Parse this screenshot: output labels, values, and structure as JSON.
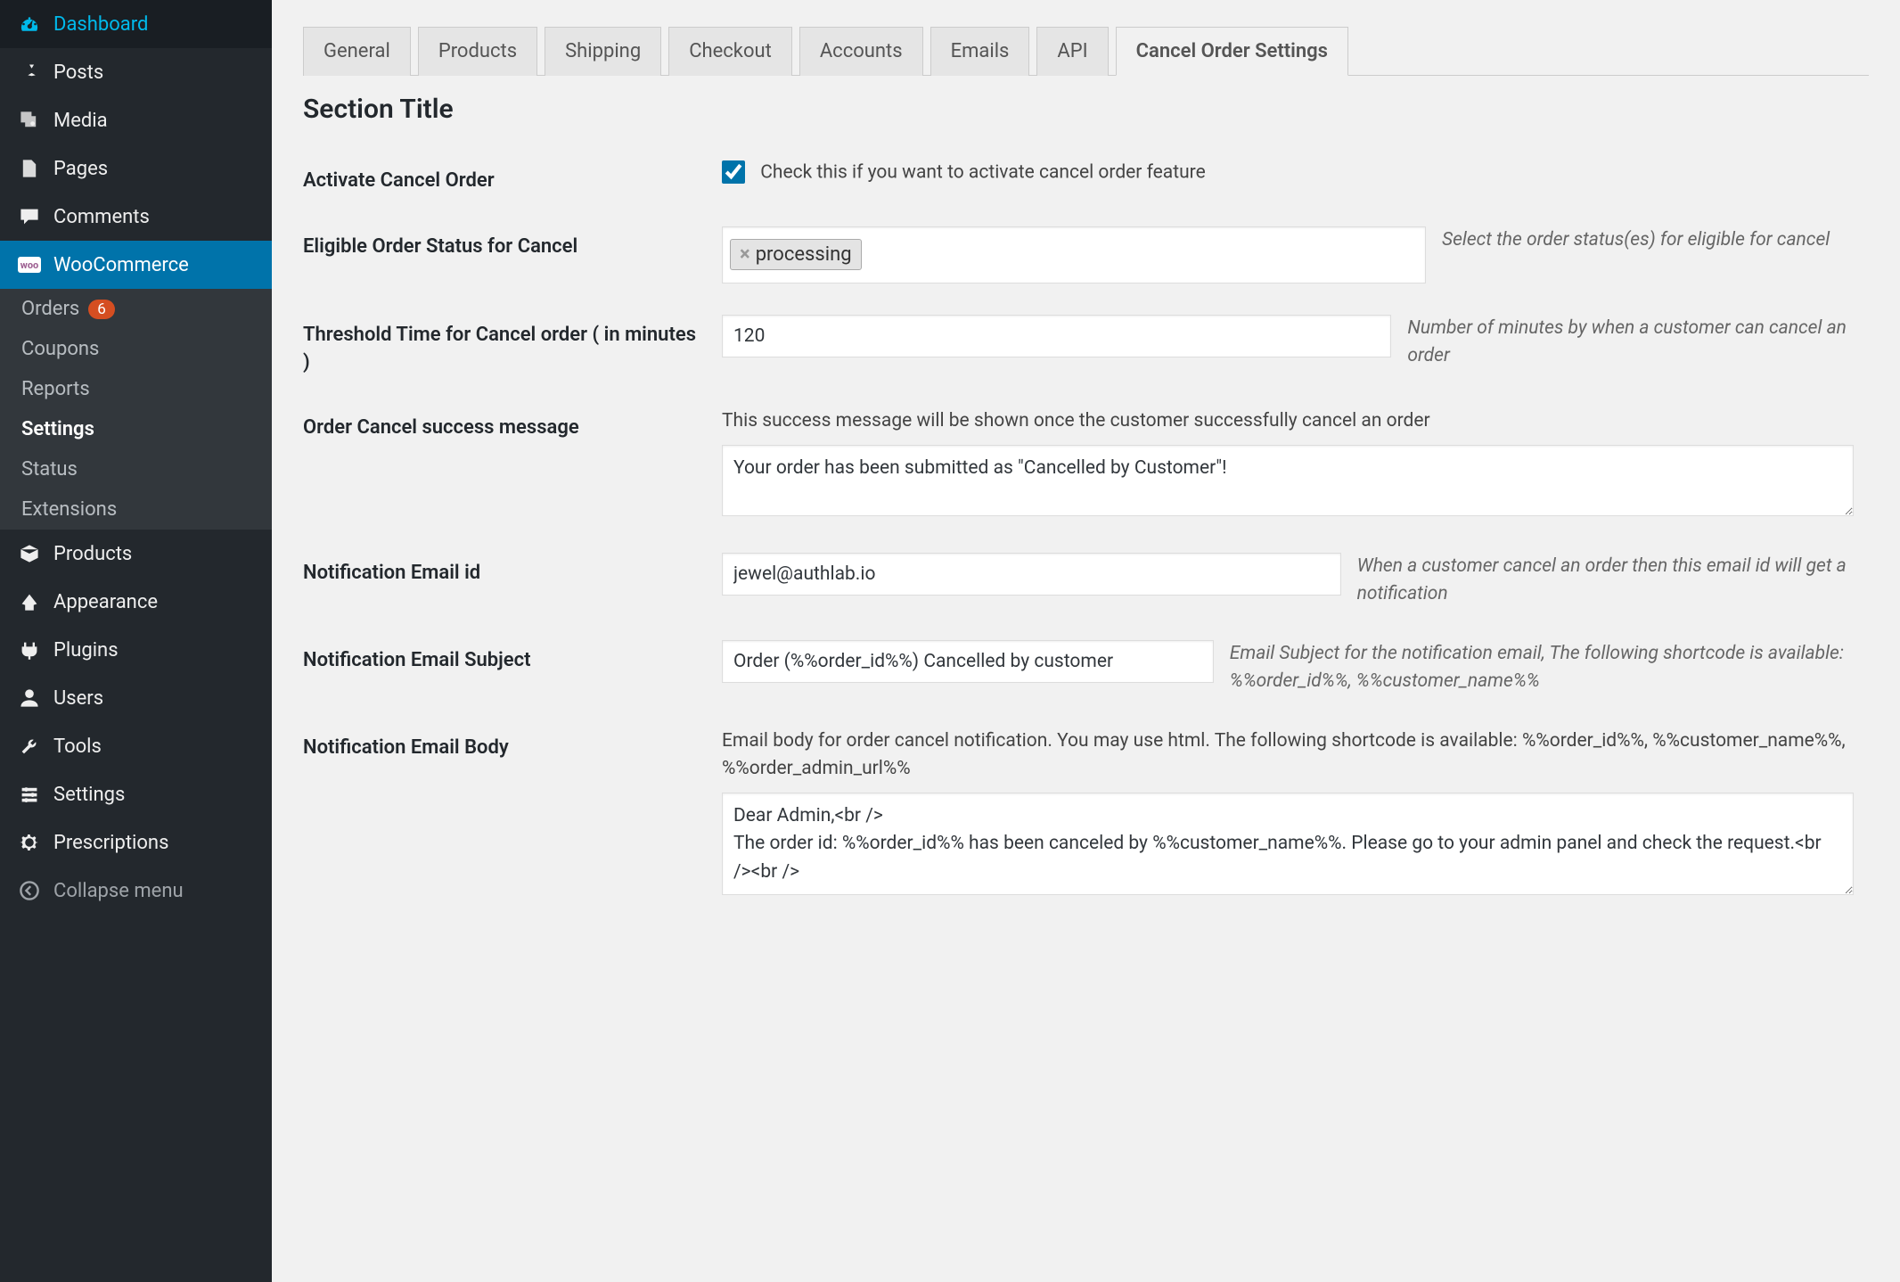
{
  "sidebar": {
    "items": [
      {
        "label": "Dashboard"
      },
      {
        "label": "Posts"
      },
      {
        "label": "Media"
      },
      {
        "label": "Pages"
      },
      {
        "label": "Comments"
      },
      {
        "label": "WooCommerce"
      },
      {
        "label": "Products"
      },
      {
        "label": "Appearance"
      },
      {
        "label": "Plugins"
      },
      {
        "label": "Users"
      },
      {
        "label": "Tools"
      },
      {
        "label": "Settings"
      },
      {
        "label": "Prescriptions"
      },
      {
        "label": "Collapse menu"
      }
    ],
    "woo_sub": [
      {
        "label": "Orders",
        "badge": "6"
      },
      {
        "label": "Coupons"
      },
      {
        "label": "Reports"
      },
      {
        "label": "Settings"
      },
      {
        "label": "Status"
      },
      {
        "label": "Extensions"
      }
    ]
  },
  "tabs": [
    {
      "label": "General"
    },
    {
      "label": "Products"
    },
    {
      "label": "Shipping"
    },
    {
      "label": "Checkout"
    },
    {
      "label": "Accounts"
    },
    {
      "label": "Emails"
    },
    {
      "label": "API"
    },
    {
      "label": "Cancel Order Settings"
    }
  ],
  "section_title": "Section Title",
  "fields": {
    "activate": {
      "label": "Activate Cancel Order",
      "checkbox_label": "Check this if you want to activate cancel order feature",
      "checked": true
    },
    "eligible_status": {
      "label": "Eligible Order Status for Cancel",
      "tag": "processing",
      "help": "Select the order status(es) for eligible for cancel"
    },
    "threshold": {
      "label": "Threshold Time for Cancel order ( in minutes )",
      "value": "120",
      "help": "Number of minutes by when a customer can cancel an order"
    },
    "success_msg": {
      "label": "Order Cancel success message",
      "desc": "This success message will be shown once the customer successfully cancel an order",
      "value": "Your order has been submitted as \"Cancelled by Customer\"!"
    },
    "email_id": {
      "label": "Notification Email id",
      "value": "jewel@authlab.io",
      "help": "When a customer cancel an order then this email id will get a notification"
    },
    "email_subject": {
      "label": "Notification Email Subject",
      "value": "Order (%%order_id%%) Cancelled by customer",
      "help": "Email Subject for the notification email, The following shortcode is available: %%order_id%%, %%customer_name%%"
    },
    "email_body": {
      "label": "Notification Email Body",
      "desc": "Email body for order cancel notification. You may use html. The following shortcode is available: %%order_id%%, %%customer_name%%, %%order_admin_url%%",
      "value": "Dear Admin,<br />\nThe order id: %%order_id%% has been canceled by %%customer_name%%. Please go to your admin panel and check the request.<br /><br />"
    }
  }
}
